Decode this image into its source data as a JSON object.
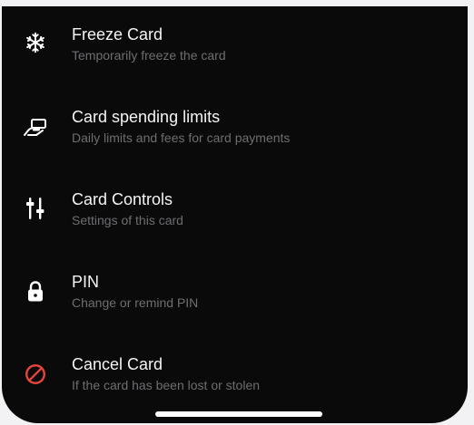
{
  "menu": {
    "items": [
      {
        "title": "Freeze Card",
        "subtitle": "Temporarily freeze the card",
        "icon": "snowflake-icon"
      },
      {
        "title": "Card spending limits",
        "subtitle": "Daily limits and fees for card payments",
        "icon": "hand-card-icon"
      },
      {
        "title": "Card Controls",
        "subtitle": "Settings of this card",
        "icon": "sliders-icon"
      },
      {
        "title": "PIN",
        "subtitle": "Change or remind PIN",
        "icon": "lock-icon"
      },
      {
        "title": "Cancel Card",
        "subtitle": "If the card has been lost or stolen",
        "icon": "cancel-icon"
      }
    ]
  },
  "colors": {
    "background": "#0a0a0a",
    "title_text": "#f4f4f4",
    "subtitle_text": "#6e6e72",
    "icon": "#ffffff",
    "danger": "#e5453b"
  }
}
